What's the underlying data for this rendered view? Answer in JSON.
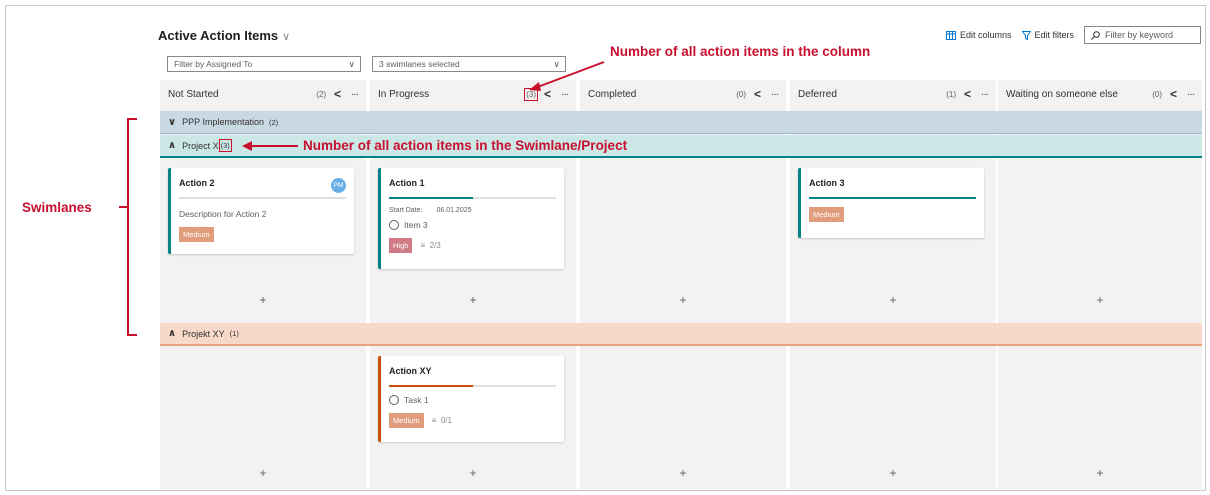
{
  "header": {
    "title": "Active Action Items",
    "edit_columns": "Edit columns",
    "edit_filters": "Edit filters",
    "keyword_placeholder": "Filter by keyword"
  },
  "filters": {
    "assigned_to": "Filter by Assigned To",
    "swimlanes": "3 swimlanes selected"
  },
  "columns": [
    {
      "name": "Not Started",
      "count": "(2)"
    },
    {
      "name": "In Progress",
      "count": "(3)"
    },
    {
      "name": "Completed",
      "count": "(0)"
    },
    {
      "name": "Deferred",
      "count": "(1)"
    },
    {
      "name": "Waiting on someone else",
      "count": "(0)"
    }
  ],
  "swimlanes": [
    {
      "name": "PPP Implementation",
      "count": "(2)"
    },
    {
      "name": "Project X",
      "count": "(3)"
    },
    {
      "name": "Projekt XY",
      "count": "(1)"
    }
  ],
  "cards": {
    "action2": {
      "title": "Action 2",
      "description": "Description for Action 2",
      "priority": "Medium",
      "avatar": "PM"
    },
    "action1": {
      "title": "Action 1",
      "start_label": "Start Date:",
      "start_value": "06.01.2025",
      "task": "Item 3",
      "priority": "High",
      "checklist": "2/3",
      "progress": 0.5
    },
    "action3": {
      "title": "Action 3",
      "priority": "Medium",
      "progress": 1.0
    },
    "actionxy": {
      "title": "Action XY",
      "task": "Task 1",
      "priority": "Medium",
      "checklist": "0/1",
      "progress": 0.5
    }
  },
  "annotations": {
    "column_count": "Number of all action items in the column",
    "swimlane_count": "Number of all action items in the Swimlane/Project",
    "swimlanes": "Swimlanes"
  },
  "colors": {
    "accent_teal": "#038387",
    "accent_orange": "#ca5010",
    "priority_medium": "#e19c7c",
    "priority_high": "#d07a85",
    "lane_ppp": "#c9d9e4",
    "lane_projectx": "#cbe8e7",
    "lane_projektxy": "#f7d8c9",
    "annotation_red": "#c8102e"
  }
}
